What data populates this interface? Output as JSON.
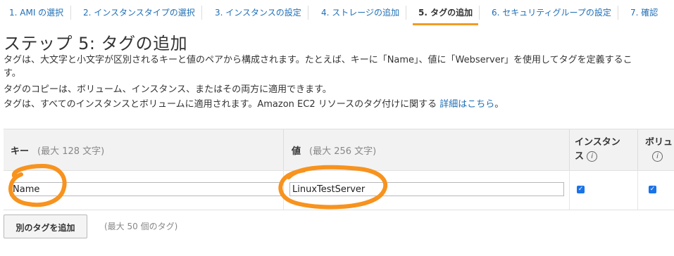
{
  "steps": [
    {
      "label": "1. AMI の選択"
    },
    {
      "label": "2. インスタンスタイプの選択"
    },
    {
      "label": "3. インスタンスの設定"
    },
    {
      "label": "4. ストレージの追加"
    },
    {
      "label": "5. タグの追加"
    },
    {
      "label": "6. セキュリティグループの設定"
    },
    {
      "label": "7. 確認"
    }
  ],
  "page_title": "ステップ 5: タグの追加",
  "description": {
    "line1": "タグは、大文字と小文字が区別されるキーと値のペアから構成されます。たとえば、キーに「Name」、値に「Webserver」を使用してタグを定義するこ",
    "line2": "す。",
    "line3": "タグのコピーは、ボリューム、インスタンス、またはその両方に適用できます。",
    "line4": "タグは、すべてのインスタンスとボリュームに適用されます。Amazon EC2 リソースのタグ付けに関する ",
    "link": "詳細はこちら",
    "line4_end": "。"
  },
  "table": {
    "key_header": "キー",
    "key_hint": "(最大 128 文字)",
    "value_header": "値",
    "value_hint": "(最大 256 文字)",
    "instances_header_1": "インスタン",
    "instances_header_2": "ス",
    "volumes_header_1": "ボリュ",
    "info_icon": "i",
    "rows": [
      {
        "key": "Name",
        "value": "LinuxTestServer",
        "instances": true,
        "volumes": true
      }
    ]
  },
  "add_tag_button": "別のタグを追加",
  "max_tags_note": "(最大 50 個のタグ)",
  "colors": {
    "accent": "#f29b24",
    "link": "#1f6fb5",
    "checkbox": "#1a73e8",
    "annotation": "#f7931e"
  }
}
